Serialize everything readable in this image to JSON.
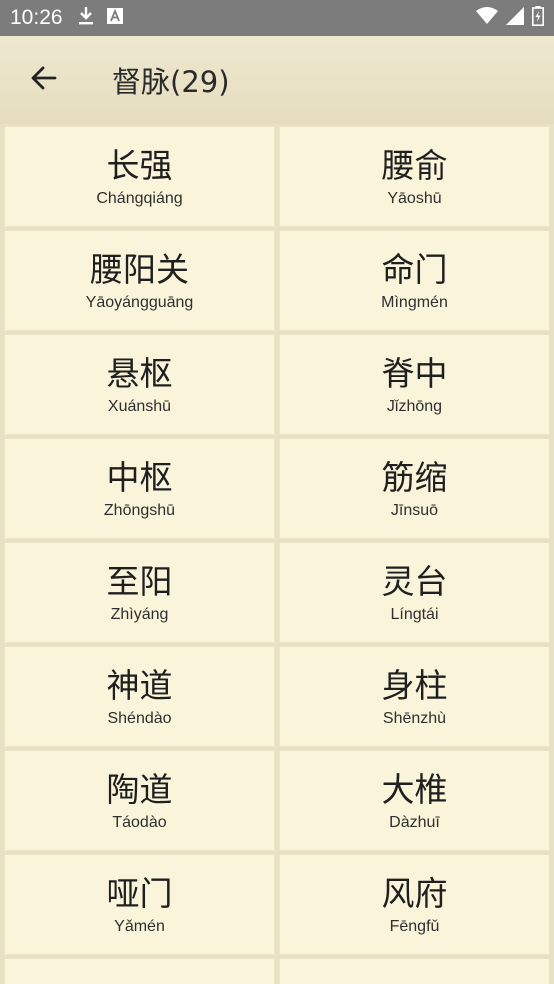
{
  "status_bar": {
    "time": "10:26",
    "left_icons": [
      "download-icon",
      "text-a-icon"
    ],
    "right_icons": [
      "wifi-icon",
      "signal-icon",
      "battery-icon"
    ]
  },
  "header": {
    "title": "督脉(29)",
    "back_icon": "arrow-left-icon"
  },
  "points": [
    {
      "name": "长强",
      "pinyin": "Chángqiáng"
    },
    {
      "name": "腰俞",
      "pinyin": "Yāoshū"
    },
    {
      "name": "腰阳关",
      "pinyin": "Yāoyángguāng"
    },
    {
      "name": "命门",
      "pinyin": "Mìngmén"
    },
    {
      "name": "悬枢",
      "pinyin": "Xuánshū"
    },
    {
      "name": "脊中",
      "pinyin": "Jǐzhōng"
    },
    {
      "name": "中枢",
      "pinyin": "Zhōngshū"
    },
    {
      "name": "筋缩",
      "pinyin": "Jīnsuō"
    },
    {
      "name": "至阳",
      "pinyin": "Zhìyáng"
    },
    {
      "name": "灵台",
      "pinyin": "Língtái"
    },
    {
      "name": "神道",
      "pinyin": "Shéndào"
    },
    {
      "name": "身柱",
      "pinyin": "Shēnzhù"
    },
    {
      "name": "陶道",
      "pinyin": "Táodào"
    },
    {
      "name": "大椎",
      "pinyin": "Dàzhuī"
    },
    {
      "name": "哑门",
      "pinyin": "Yǎmén"
    },
    {
      "name": "风府",
      "pinyin": "Fēngfǔ"
    }
  ],
  "colors": {
    "status_bar": "#7c7c7c",
    "background": "#e9e1c6",
    "cell": "#faf4db"
  }
}
